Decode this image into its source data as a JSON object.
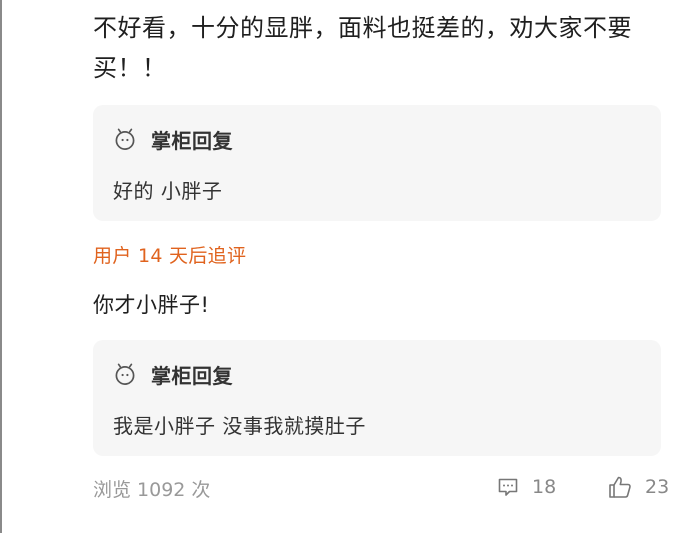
{
  "review": {
    "text": "不好看，十分的显胖，面料也挺差的，劝大家不要买！！"
  },
  "replies": [
    {
      "icon": "smile-icon",
      "title": "掌柜回复",
      "body": "好的 小胖子"
    },
    {
      "icon": "smile-icon",
      "title": "掌柜回复",
      "body": "我是小胖子  没事我就摸肚子"
    }
  ],
  "followup": {
    "label": "用户 14 天后追评",
    "text": "你才小胖子!"
  },
  "footer": {
    "views": "浏览 1092 次",
    "comment_icon": "comment-icon",
    "comments": "18",
    "like_icon": "thumbs-up-icon",
    "likes": "23"
  },
  "colors": {
    "followup_accent": "#e0631e",
    "reply_background": "#f6f6f6",
    "muted_text": "#999999"
  }
}
